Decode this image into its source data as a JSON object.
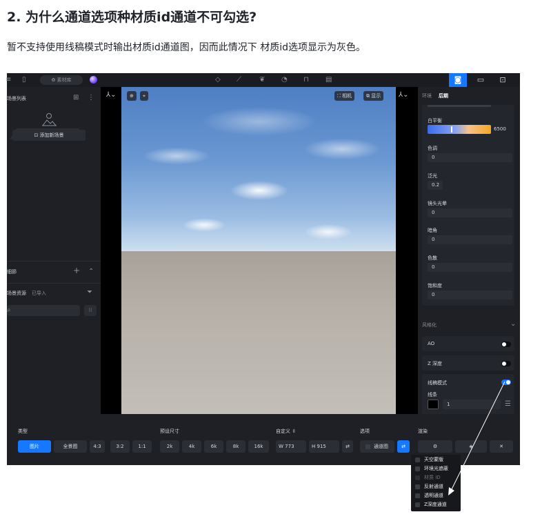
{
  "doc": {
    "title": "2. 为什么通道选项种材质id通道不可勾选?",
    "paragraph": "暂不支持使用线稿模式时输出材质id通道图，因而此情况下 材质id选项显示为灰色。"
  },
  "topbar": {
    "library_label": "素材库"
  },
  "left_panel": {
    "scene_list_label": "场景列表",
    "add_scene_label": "添加新场景",
    "section_label": "细節",
    "assets_tab": "场景资源",
    "imported_tab": "已导入"
  },
  "viewport": {
    "camera_label": "相机",
    "display_label": "显示"
  },
  "right_panel": {
    "tab_env": "环境",
    "tab_post": "后期",
    "white_balance_label": "白平衡",
    "white_balance_value": "6500",
    "fields": [
      {
        "label": "色调",
        "value": "0"
      },
      {
        "label": "泛光",
        "value": "0.2"
      },
      {
        "label": "镜头光晕",
        "value": "0"
      },
      {
        "label": "暗角",
        "value": "0"
      },
      {
        "label": "色散",
        "value": "0"
      },
      {
        "label": "饱和度",
        "value": "0"
      }
    ],
    "stylize_label": "风格化",
    "ao_label": "AO",
    "ao_on": false,
    "zdepth_label": "Z 深度",
    "zdepth_on": false,
    "wireframe_label": "线稿模式",
    "wireframe_on": true,
    "lines_label": "线条",
    "lines_value": "1"
  },
  "bottom_bar": {
    "type_label": "类型",
    "type_image": "图片",
    "type_panorama": "全景图",
    "ratios": [
      "4:3",
      "3:2",
      "1:1"
    ],
    "preset_label": "预设尺寸",
    "presets": [
      "2k",
      "4k",
      "6k",
      "8k",
      "16k"
    ],
    "custom_label": "自定义",
    "width_label": "W",
    "width_value": "773",
    "height_label": "H",
    "height_value": "915",
    "options_label": "选项",
    "channel_label": "通道图",
    "render_label": "渲染"
  },
  "channel_dropdown": {
    "items": [
      {
        "label": "天空蒙版",
        "disabled": false
      },
      {
        "label": "环境光遮蔽",
        "disabled": false
      },
      {
        "label": "材质 ID",
        "disabled": true
      },
      {
        "label": "反射通道",
        "disabled": false
      },
      {
        "label": "透明通道",
        "disabled": false
      },
      {
        "label": "Z深度通道",
        "disabled": false
      }
    ]
  },
  "colors": {
    "accent": "#1677ff",
    "panel_bg": "#1e2026",
    "annotation": "#ffffff"
  }
}
